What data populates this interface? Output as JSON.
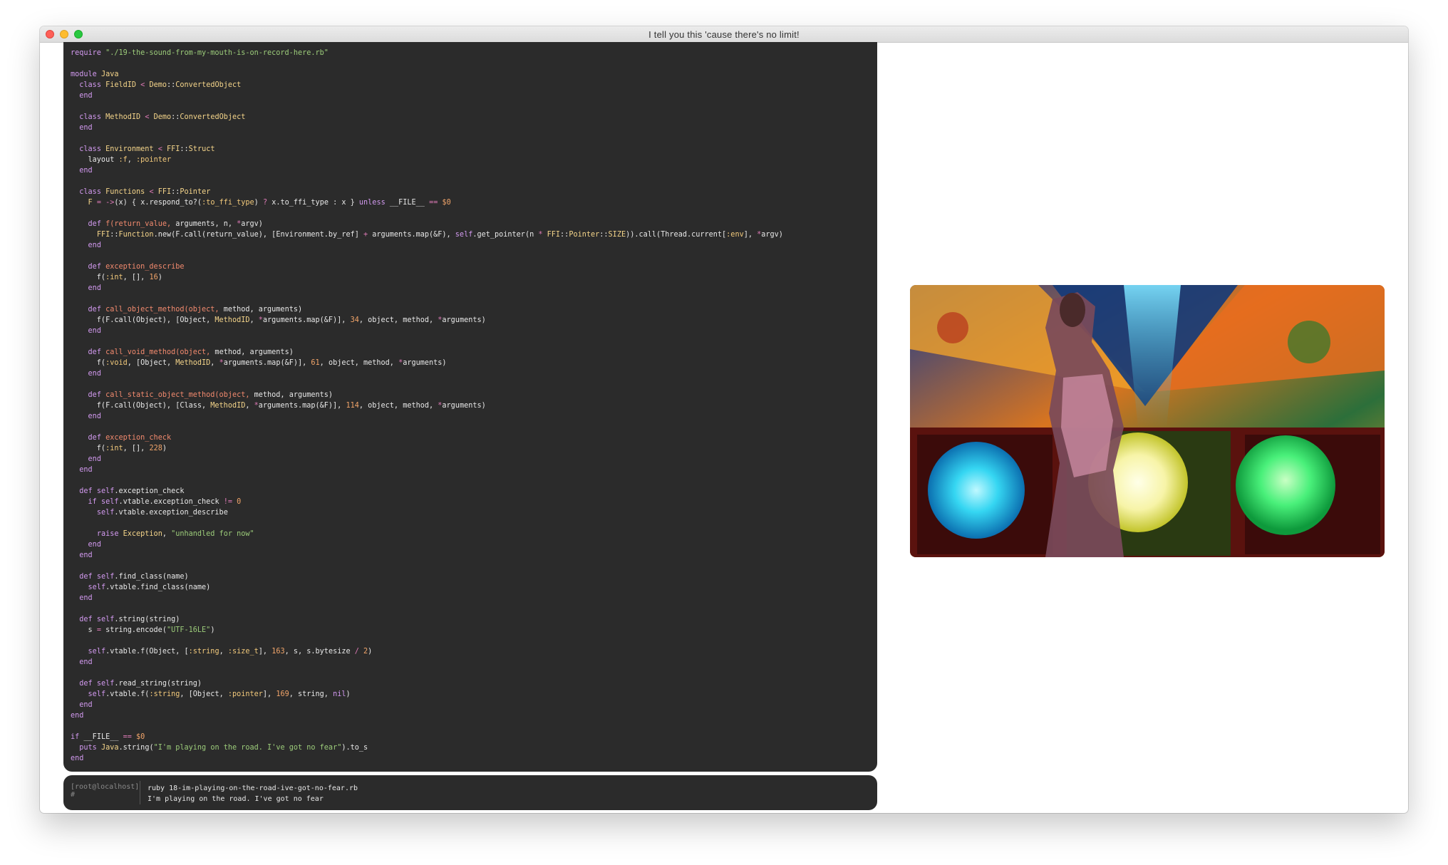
{
  "window": {
    "title": "I tell you this 'cause there's no limit!",
    "controls": [
      "close",
      "minimize",
      "maximize"
    ]
  },
  "editor": {
    "language": "ruby",
    "lines": [
      "require \"./19-the-sound-from-my-mouth-is-on-record-here.rb\"",
      "",
      "module Java",
      "  class FieldID < Demo::ConvertedObject",
      "  end",
      "",
      "  class MethodID < Demo::ConvertedObject",
      "  end",
      "",
      "  class Environment < FFI::Struct",
      "    layout :f, :pointer",
      "  end",
      "",
      "  class Functions < FFI::Pointer",
      "    F = ->(x) { x.respond_to?(:to_ffi_type) ? x.to_ffi_type : x } unless __FILE__ == $0",
      "",
      "    def f(return_value, arguments, n, *argv)",
      "      FFI::Function.new(F.call(return_value), [Environment.by_ref] + arguments.map(&F), self.get_pointer(n * FFI::Pointer::SIZE)).call(Thread.current[:env], *argv)",
      "    end",
      "",
      "    def exception_describe",
      "      f(:int, [], 16)",
      "    end",
      "",
      "    def call_object_method(object, method, arguments)",
      "      f(F.call(Object), [Object, MethodID, *arguments.map(&F)], 34, object, method, *arguments)",
      "    end",
      "",
      "    def call_void_method(object, method, arguments)",
      "      f(:void, [Object, MethodID, *arguments.map(&F)], 61, object, method, *arguments)",
      "    end",
      "",
      "    def call_static_object_method(object, method, arguments)",
      "      f(F.call(Object), [Class, MethodID, *arguments.map(&F)], 114, object, method, *arguments)",
      "    end",
      "",
      "    def exception_check",
      "      f(:int, [], 228)",
      "    end",
      "  end",
      "",
      "  def self.exception_check",
      "    if self.vtable.exception_check != 0",
      "      self.vtable.exception_describe",
      "",
      "      raise Exception, \"unhandled for now\"",
      "    end",
      "  end",
      "",
      "  def self.find_class(name)",
      "    self.vtable.find_class(name)",
      "  end",
      "",
      "  def self.string(string)",
      "    s = string.encode(\"UTF-16LE\")",
      "",
      "    self.vtable.f(Object, [:string, :size_t], 163, s, s.bytesize / 2)",
      "  end",
      "",
      "  def self.read_string(string)",
      "    self.vtable.f(:string, [Object, :pointer], 169, string, nil)",
      "  end",
      "end",
      "",
      "if __FILE__ == $0",
      "  puts Java.string(\"I'm playing on the road. I've got no fear\").to_s",
      "end"
    ]
  },
  "terminal": {
    "prompt": "[root@localhost] #",
    "command": "ruby 18-im-playing-on-the-road-ive-got-no-fear.rb",
    "output": "I'm playing on the road. I've got no fear"
  },
  "video": {
    "description_icon": "video-frame"
  },
  "colors": {
    "editor_bg": "#2b2b2b",
    "keyword": "#d39af0",
    "string": "#9ccc7a",
    "number": "#f2a56a",
    "constant": "#f5d58a",
    "method_name": "#f28a6e"
  }
}
